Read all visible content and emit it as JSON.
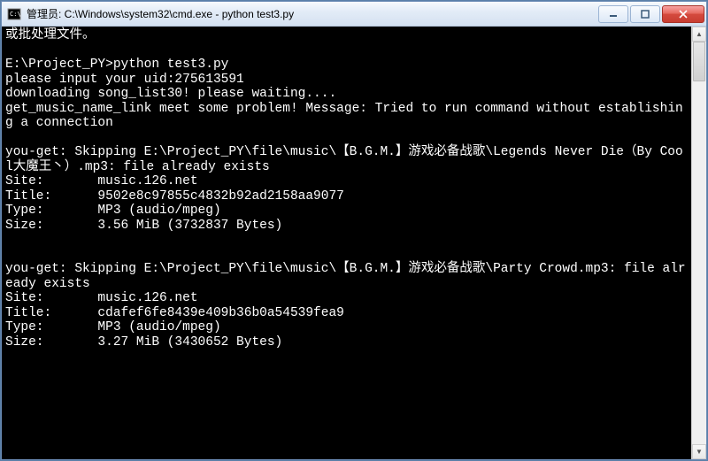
{
  "titlebar": {
    "title": "管理员: C:\\Windows\\system32\\cmd.exe - python  test3.py"
  },
  "terminal": {
    "lines": [
      "或批处理文件。",
      "",
      "E:\\Project_PY>python test3.py",
      "please input your uid:275613591",
      "downloading song_list30! please waiting....",
      "get_music_name_link meet some problem! Message: Tried to run command without establishing a connection",
      "",
      "you-get: Skipping E:\\Project_PY\\file\\music\\【B.G.M.】游戏必备战歌\\Legends Never Die（By Cool大魔王丶）.mp3: file already exists",
      "Site:       music.126.net",
      "Title:      9502e8c97855c4832b92ad2158aa9077",
      "Type:       MP3 (audio/mpeg)",
      "Size:       3.56 MiB (3732837 Bytes)",
      "",
      "",
      "you-get: Skipping E:\\Project_PY\\file\\music\\【B.G.M.】游戏必备战歌\\Party Crowd.mp3: file already exists",
      "Site:       music.126.net",
      "Title:      cdafef6fe8439e409b36b0a54539fea9",
      "Type:       MP3 (audio/mpeg)",
      "Size:       3.27 MiB (3430652 Bytes)",
      ""
    ]
  }
}
